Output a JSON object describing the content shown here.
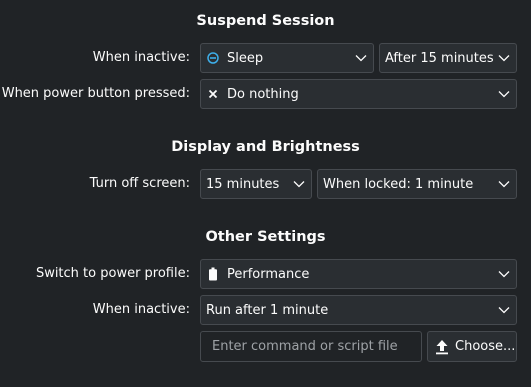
{
  "suspend_session": {
    "title": "Suspend Session",
    "when_inactive": {
      "label": "When inactive:",
      "action": {
        "value": "Sleep",
        "icon": "sleep-icon"
      },
      "delay": {
        "value": "After 15 minutes"
      }
    },
    "power_button": {
      "label": "When power button pressed:",
      "action": {
        "value": "Do nothing",
        "icon": "close-icon"
      }
    }
  },
  "display_brightness": {
    "title": "Display and Brightness",
    "turn_off_screen": {
      "label": "Turn off screen:",
      "delay": {
        "value": "15 minutes"
      },
      "locked": {
        "value": "When locked: 1 minute"
      }
    }
  },
  "other_settings": {
    "title": "Other Settings",
    "power_profile": {
      "label": "Switch to power profile:",
      "value": "Performance",
      "icon": "battery-icon"
    },
    "when_inactive": {
      "label": "When inactive:",
      "value": "Run after 1 minute",
      "command_placeholder": "Enter command or script file",
      "choose_label": "Choose...",
      "choose_icon": "upload-icon"
    }
  },
  "colors": {
    "background": "#202326",
    "field_background": "#2a2e32",
    "border": "#464a4f",
    "text": "#fcfcfc",
    "placeholder": "#9ea2a6",
    "accent": "#3daee9"
  }
}
